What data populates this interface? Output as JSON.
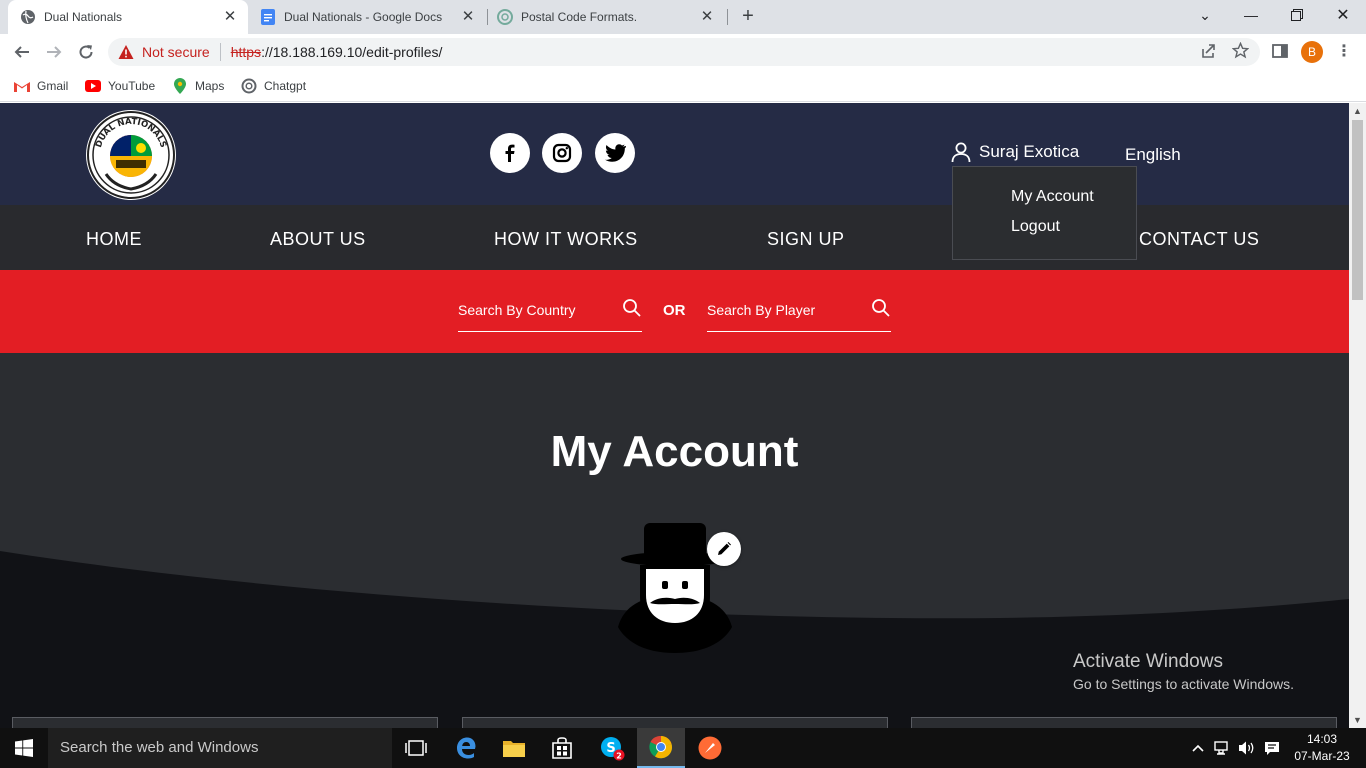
{
  "browser": {
    "tabs": [
      {
        "title": "Dual Nationals",
        "active": true
      },
      {
        "title": "Dual Nationals - Google Docs",
        "active": false
      },
      {
        "title": "Postal Code Formats.",
        "active": false
      }
    ],
    "security_label": "Not secure",
    "url_scheme": "https",
    "url_rest": "://18.188.169.10/edit-profiles/",
    "profile_initial": "B",
    "bookmarks": [
      {
        "label": "Gmail"
      },
      {
        "label": "YouTube"
      },
      {
        "label": "Maps"
      },
      {
        "label": "Chatgpt"
      }
    ]
  },
  "site": {
    "logo_text": "DUAL NATIONALS",
    "user_name": "Suraj Exotica",
    "language": "English",
    "dropdown": {
      "my_account": "My Account",
      "logout": "Logout"
    },
    "nav": [
      "HOME",
      "ABOUT US",
      "HOW IT WORKS",
      "SIGN UP",
      "CONTACT US"
    ],
    "search_country_placeholder": "Search By Country",
    "search_player_placeholder": "Search By Player",
    "or_label": "OR",
    "page_title": "My Account"
  },
  "os": {
    "activate_title": "Activate Windows",
    "activate_sub": "Go to Settings to activate Windows.",
    "taskbar_search": "Search the web and Windows",
    "skype_badge": "2",
    "time": "14:03",
    "date": "07-Mar-23"
  },
  "colors": {
    "header_bg": "#252b45",
    "nav_bg": "#292a2e",
    "search_bg": "#e31e24",
    "content_bg": "#2b2d31"
  }
}
